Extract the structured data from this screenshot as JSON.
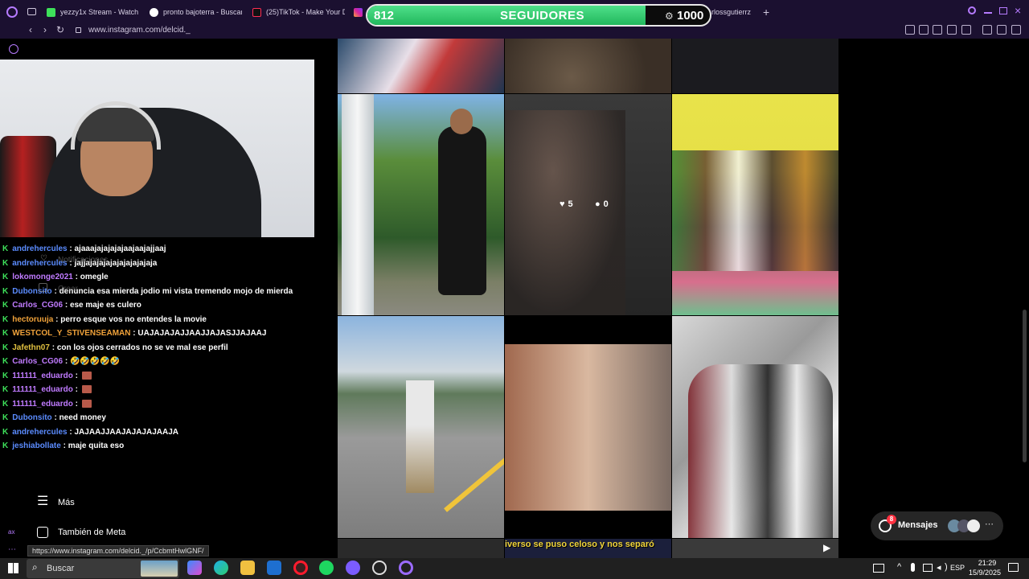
{
  "browser": {
    "tabs": [
      {
        "label": "yezzy1x Stream - Watch ..."
      },
      {
        "label": "pronto bajoterra - Buscar"
      },
      {
        "label": "(25)TikTok - Make Your D"
      },
      {
        "label": "rlossgutierrz"
      }
    ],
    "url": "www.instagram.com/delcid._"
  },
  "follower_goal": {
    "current": "812",
    "label": "SEGUIDORES",
    "goal": "1000",
    "progress": 0.812
  },
  "chat": [
    {
      "user": "andrehercules",
      "color": "#5b8cff",
      "msg": "ajaaajajajajajaajaajajjaaj"
    },
    {
      "user": "andrehercules",
      "color": "#5b8cff",
      "msg": "jajjajajajajajajajajajaja"
    },
    {
      "user": "lokomonge2021",
      "color": "#c07bff",
      "msg": "omegle"
    },
    {
      "user": "Dubonsito",
      "color": "#5b8cff",
      "msg": "denuncia esa mierda jodio mi vista tremendo mojo de mierda"
    },
    {
      "user": "Carlos_CG06",
      "color": "#c07bff",
      "msg": "ese maje es culero"
    },
    {
      "user": "hectoruuja",
      "color": "#f0a23a",
      "msg": "perro esque vos no entendes la movie"
    },
    {
      "user": "WESTCOL_Y_STIVENSEAMAN",
      "color": "#f0a23a",
      "msg": "UAJAJAJAJJAAJJAJASJJAJAAJ"
    },
    {
      "user": "Jafethn07",
      "color": "#e0c040",
      "msg": "con los ojos cerrados no se ve mal ese perfil"
    },
    {
      "user": "Carlos_CG06",
      "color": "#c07bff",
      "msg": "🤣🤣🤣🤣🤣",
      "emoji": true
    },
    {
      "user": "111111_eduardo",
      "color": "#c07bff",
      "msg": "",
      "emote": true
    },
    {
      "user": "111111_eduardo",
      "color": "#c07bff",
      "msg": "",
      "emote": true
    },
    {
      "user": "111111_eduardo",
      "color": "#c07bff",
      "msg": "",
      "emote": true
    },
    {
      "user": "Dubonsito",
      "color": "#5b8cff",
      "msg": "need money"
    },
    {
      "user": "andrehercules",
      "color": "#5b8cff",
      "msg": "JAJAAJJAAJAJAJAJAAJA"
    },
    {
      "user": "jeshiabollate",
      "color": "#5b8cff",
      "msg": "maje quita eso"
    }
  ],
  "instagram_sidebar": {
    "notifications_label": "Notificaciones",
    "create_label": "Crear",
    "more_label": "Más",
    "meta_label": "También de Meta"
  },
  "post_hover": {
    "likes": "5",
    "comments": "0"
  },
  "reel_caption": "iverso se puso celoso y nos separó",
  "messages": {
    "label": "Mensajes",
    "badge": "8"
  },
  "status_url": "https://www.instagram.com/delcid._/p/CcbmtHwlGNF/",
  "taskbar": {
    "search_label": "Buscar",
    "language": "ESP",
    "time": "21:29",
    "date": "15/9/2025"
  },
  "colors": {
    "browser_bg": "#1b1030",
    "progress_green": "#2ecc71",
    "kick_green": "#3ee05a"
  }
}
